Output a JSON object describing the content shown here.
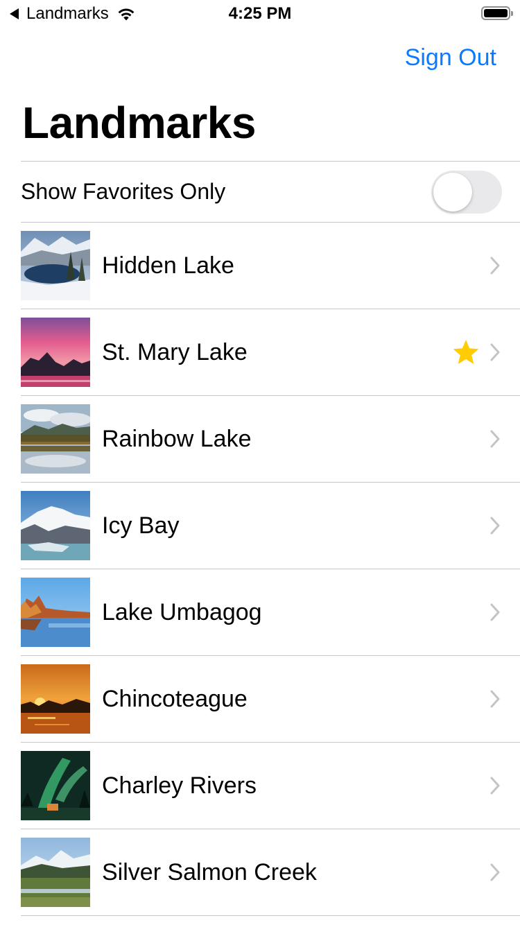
{
  "status_bar": {
    "back_app": "Landmarks",
    "time": "4:25 PM"
  },
  "nav": {
    "sign_out": "Sign Out",
    "title": "Landmarks"
  },
  "favorites_toggle": {
    "label": "Show Favorites Only",
    "on": false
  },
  "colors": {
    "accent": "#0a7aff",
    "star": "#ffcc00",
    "separator": "#c6c6c8",
    "chevron": "#c4c4c7"
  },
  "landmarks": [
    {
      "name": "Hidden Lake",
      "favorite": false
    },
    {
      "name": "St. Mary Lake",
      "favorite": true
    },
    {
      "name": "Rainbow Lake",
      "favorite": false
    },
    {
      "name": "Icy Bay",
      "favorite": false
    },
    {
      "name": "Lake Umbagog",
      "favorite": false
    },
    {
      "name": "Chincoteague",
      "favorite": false
    },
    {
      "name": "Charley Rivers",
      "favorite": false
    },
    {
      "name": "Silver Salmon Creek",
      "favorite": false
    }
  ]
}
